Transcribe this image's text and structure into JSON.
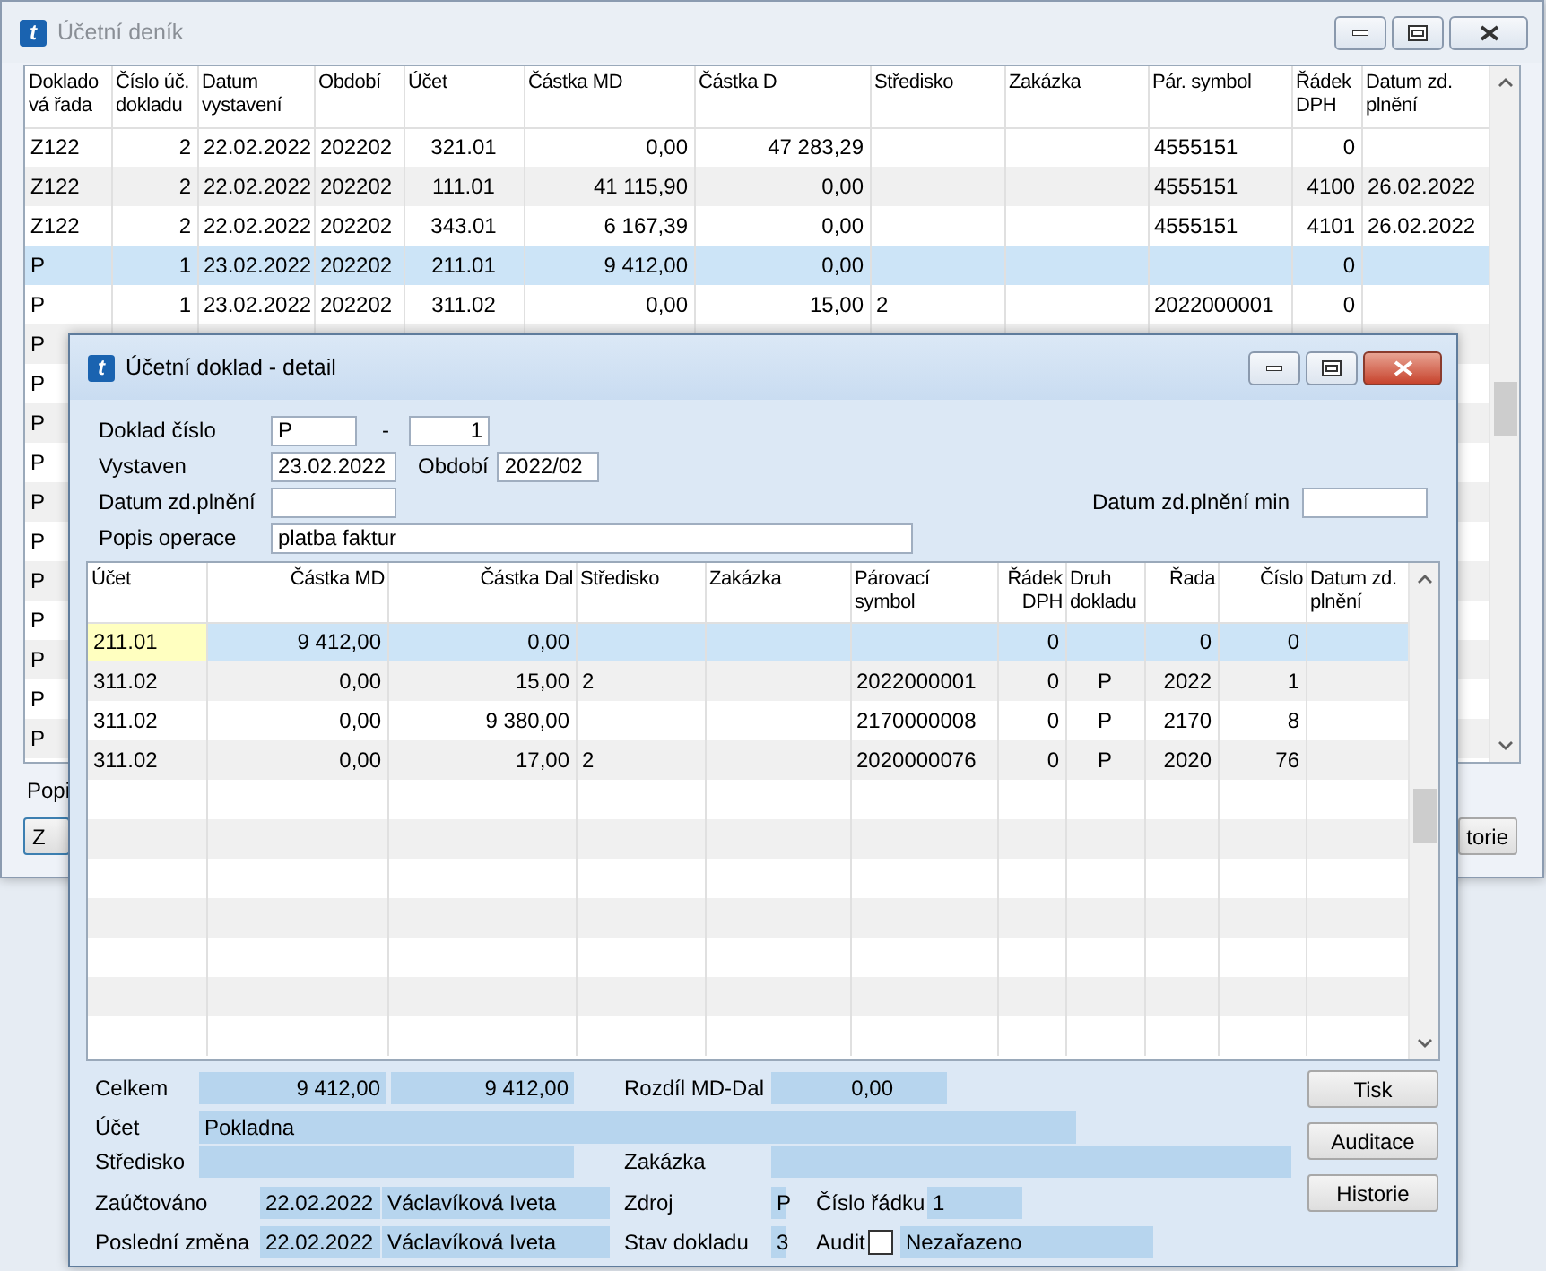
{
  "main_window": {
    "icon_letter": "t",
    "title": "Účetní deník",
    "active": false,
    "columns": [
      "Doklado vá řada",
      "Číslo úč. dokladu",
      "Datum vystavení",
      "Období",
      "Účet",
      "Částka MD",
      "Částka D",
      "Středisko",
      "Zakázka",
      "Pár. symbol",
      "Řádek DPH",
      "Datum zd. plnění"
    ],
    "rows": [
      {
        "selected": false,
        "cells": [
          "Z122",
          "2",
          "22.02.2022",
          "202202",
          "321.01",
          "0,00",
          "47 283,29",
          "",
          "",
          "4555151",
          "0",
          ""
        ]
      },
      {
        "selected": false,
        "cells": [
          "Z122",
          "2",
          "22.02.2022",
          "202202",
          "111.01",
          "41 115,90",
          "0,00",
          "",
          "",
          "4555151",
          "4100",
          "26.02.2022"
        ]
      },
      {
        "selected": false,
        "cells": [
          "Z122",
          "2",
          "22.02.2022",
          "202202",
          "343.01",
          "6 167,39",
          "0,00",
          "",
          "",
          "4555151",
          "4101",
          "26.02.2022"
        ]
      },
      {
        "selected": true,
        "cells": [
          "P",
          "1",
          "23.02.2022",
          "202202",
          "211.01",
          "9 412,00",
          "0,00",
          "",
          "",
          "",
          "0",
          ""
        ]
      },
      {
        "selected": false,
        "cells": [
          "P",
          "1",
          "23.02.2022",
          "202202",
          "311.02",
          "0,00",
          "15,00",
          "2",
          "",
          "2022000001",
          "0",
          ""
        ]
      },
      {
        "selected": false,
        "cells": [
          "P"
        ]
      },
      {
        "selected": false,
        "cells": [
          "P"
        ]
      },
      {
        "selected": false,
        "cells": [
          "P"
        ]
      },
      {
        "selected": false,
        "cells": [
          "P"
        ]
      },
      {
        "selected": false,
        "cells": [
          "P"
        ]
      },
      {
        "selected": false,
        "cells": [
          "P"
        ]
      },
      {
        "selected": false,
        "cells": [
          "P"
        ]
      },
      {
        "selected": false,
        "cells": [
          "P"
        ]
      },
      {
        "selected": false,
        "cells": [
          "P"
        ]
      },
      {
        "selected": false,
        "cells": [
          "P"
        ]
      },
      {
        "selected": false,
        "cells": [
          "P"
        ]
      }
    ],
    "footer_label": "Popi",
    "buttons": [
      "Z",
      "torie"
    ]
  },
  "dialog": {
    "icon_letter": "t",
    "title": "Účetní doklad - detail",
    "active": true,
    "form": {
      "doklad_cislo": {
        "label": "Doklad číslo",
        "series": "P",
        "separator": "-",
        "number": "1"
      },
      "vystaven": {
        "label": "Vystaven",
        "value": "23.02.2022"
      },
      "obdobi": {
        "label": "Období",
        "value": "2022/02"
      },
      "datum_zd_plneni": {
        "label": "Datum zd.plnění"
      },
      "datum_zd_plneni_min": {
        "label": "Datum zd.plnění min"
      },
      "popis_operace": {
        "label": "Popis operace",
        "value": "platba faktur"
      }
    },
    "table": {
      "columns": [
        "Účet",
        "Částka MD",
        "Částka Dal",
        "Středisko",
        "Zakázka",
        "Párovací symbol",
        "Řádek DPH",
        "Druh dokladu",
        "Řada",
        "Číslo",
        "Datum zd. plnění"
      ],
      "rows": [
        {
          "selected": true,
          "editing": true,
          "cells": [
            "211.01",
            "9 412,00",
            "0,00",
            "",
            "",
            "",
            "0",
            "",
            "0",
            "0",
            ""
          ]
        },
        {
          "selected": false,
          "editing": false,
          "cells": [
            "311.02",
            "0,00",
            "15,00",
            "2",
            "",
            "2022000001",
            "0",
            "P",
            "2022",
            "1",
            ""
          ]
        },
        {
          "selected": false,
          "editing": false,
          "cells": [
            "311.02",
            "0,00",
            "9 380,00",
            "",
            "",
            "2170000008",
            "0",
            "P",
            "2170",
            "8",
            ""
          ]
        },
        {
          "selected": false,
          "editing": false,
          "cells": [
            "311.02",
            "0,00",
            "17,00",
            "2",
            "",
            "2020000076",
            "0",
            "P",
            "2020",
            "76",
            ""
          ]
        }
      ]
    },
    "summary": {
      "celkem": {
        "label": "Celkem",
        "md": "9 412,00",
        "dal": "9 412,00"
      },
      "rozdil": {
        "label": "Rozdíl MD-Dal",
        "value": "0,00"
      },
      "ucet": {
        "label": "Účet",
        "value": "Pokladna"
      },
      "stredisko": {
        "label": "Středisko"
      },
      "zakazka": {
        "label": "Zakázka"
      },
      "zauctovano": {
        "label": "Zaúčtováno",
        "date": "22.02.2022",
        "user": "Václavíková Iveta"
      },
      "posledni_zmena": {
        "label": "Poslední změna",
        "date": "22.02.2022",
        "user": "Václavíková Iveta"
      },
      "zdroj": {
        "label": "Zdroj",
        "value": "P"
      },
      "cislo_radku": {
        "label": "Číslo řádku",
        "value": "1"
      },
      "stav_dokladu": {
        "label": "Stav dokladu",
        "value": "3"
      },
      "audit": {
        "label": "Audit",
        "checked": false,
        "value": "Nezařazeno"
      }
    },
    "buttons": [
      "Tisk",
      "Auditace",
      "Historie"
    ]
  }
}
